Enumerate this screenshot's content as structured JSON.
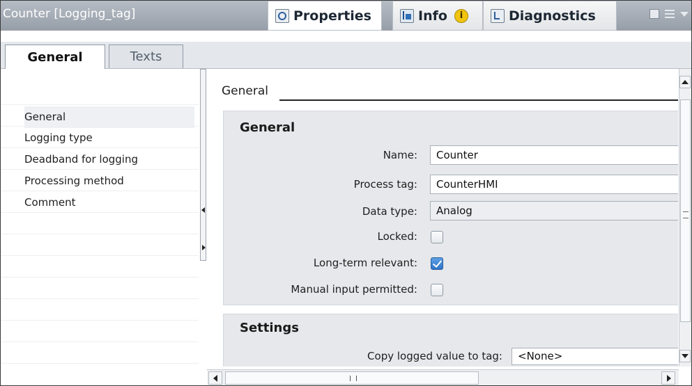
{
  "window": {
    "title": "Counter [Logging_tag]"
  },
  "inspector_tabs": [
    {
      "label": "Properties",
      "icon": "properties-icon"
    },
    {
      "label": "Info",
      "icon": "info-icon",
      "badge": "i"
    },
    {
      "label": "Diagnostics",
      "icon": "diagnostics-icon"
    }
  ],
  "sub_tabs": [
    {
      "label": "General"
    },
    {
      "label": "Texts"
    }
  ],
  "sidebar": {
    "items": [
      {
        "label": "General"
      },
      {
        "label": "Logging type"
      },
      {
        "label": "Deadband for logging"
      },
      {
        "label": "Processing method"
      },
      {
        "label": "Comment"
      }
    ]
  },
  "main": {
    "section_header": "General",
    "general_group": {
      "title": "General",
      "name_label": "Name:",
      "name_value": "Counter",
      "process_tag_label": "Process tag:",
      "process_tag_value": "CounterHMI",
      "data_type_label": "Data type:",
      "data_type_value": "Analog",
      "locked_label": "Locked:",
      "locked_checked": false,
      "long_term_label": "Long-term relevant:",
      "long_term_checked": true,
      "manual_input_label": "Manual input permitted:",
      "manual_input_checked": false
    },
    "settings_group": {
      "title": "Settings",
      "copy_logged_label": "Copy logged value to tag:",
      "copy_logged_value": "<None>"
    }
  },
  "colors": {
    "title_bar": "#a4acb6",
    "checkbox_checked": "#2f74c9",
    "group_background": "#e6e8eb"
  }
}
